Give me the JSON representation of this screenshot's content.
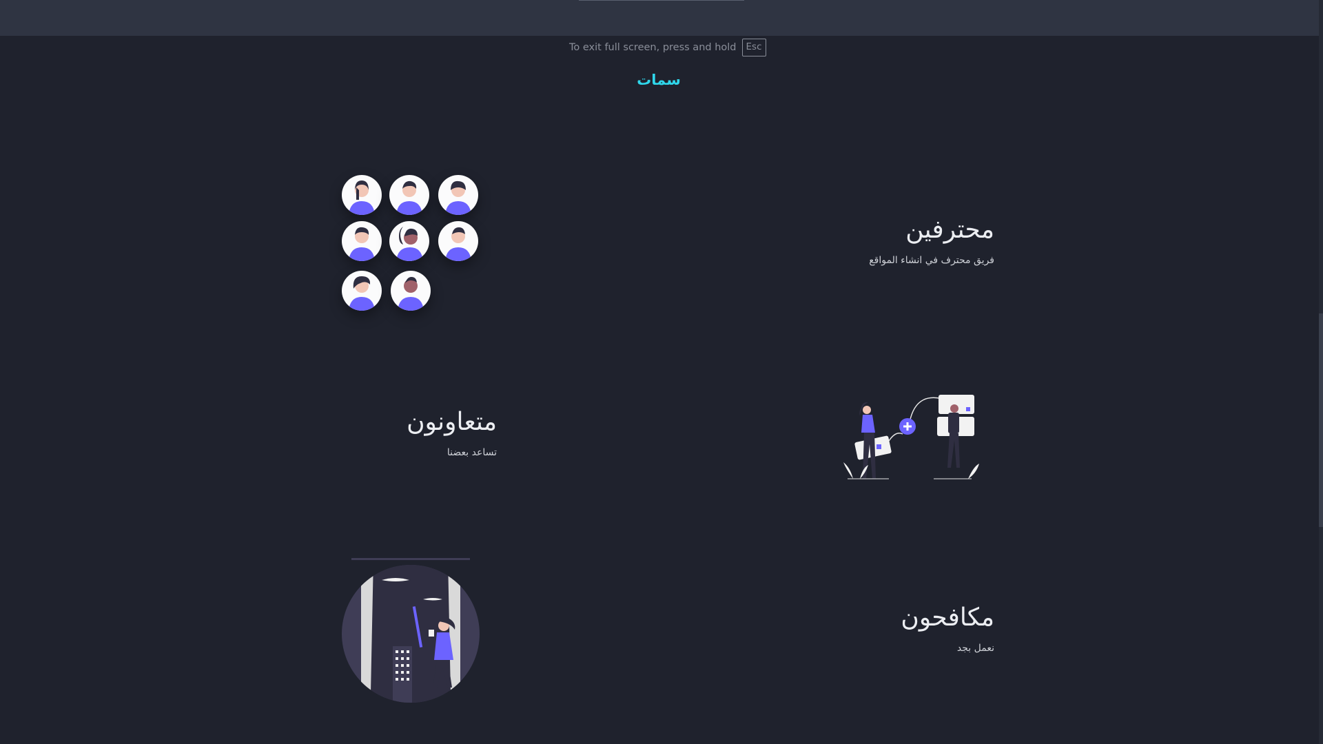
{
  "fullscreen_hint": {
    "text": "To exit full screen, press and hold",
    "key": "Esc"
  },
  "section": {
    "title": "سمات"
  },
  "features": [
    {
      "title": "محترفين",
      "description": "فريق محترف في انشاء المواقع"
    },
    {
      "title": "متعاونون",
      "description": "تساعد بعضنا"
    },
    {
      "title": "مكافحون",
      "description": "نعمل بجد"
    }
  ],
  "colors": {
    "accent": "#2fd6ea",
    "illustration": "#6c63ff",
    "background": "#1f222d"
  }
}
